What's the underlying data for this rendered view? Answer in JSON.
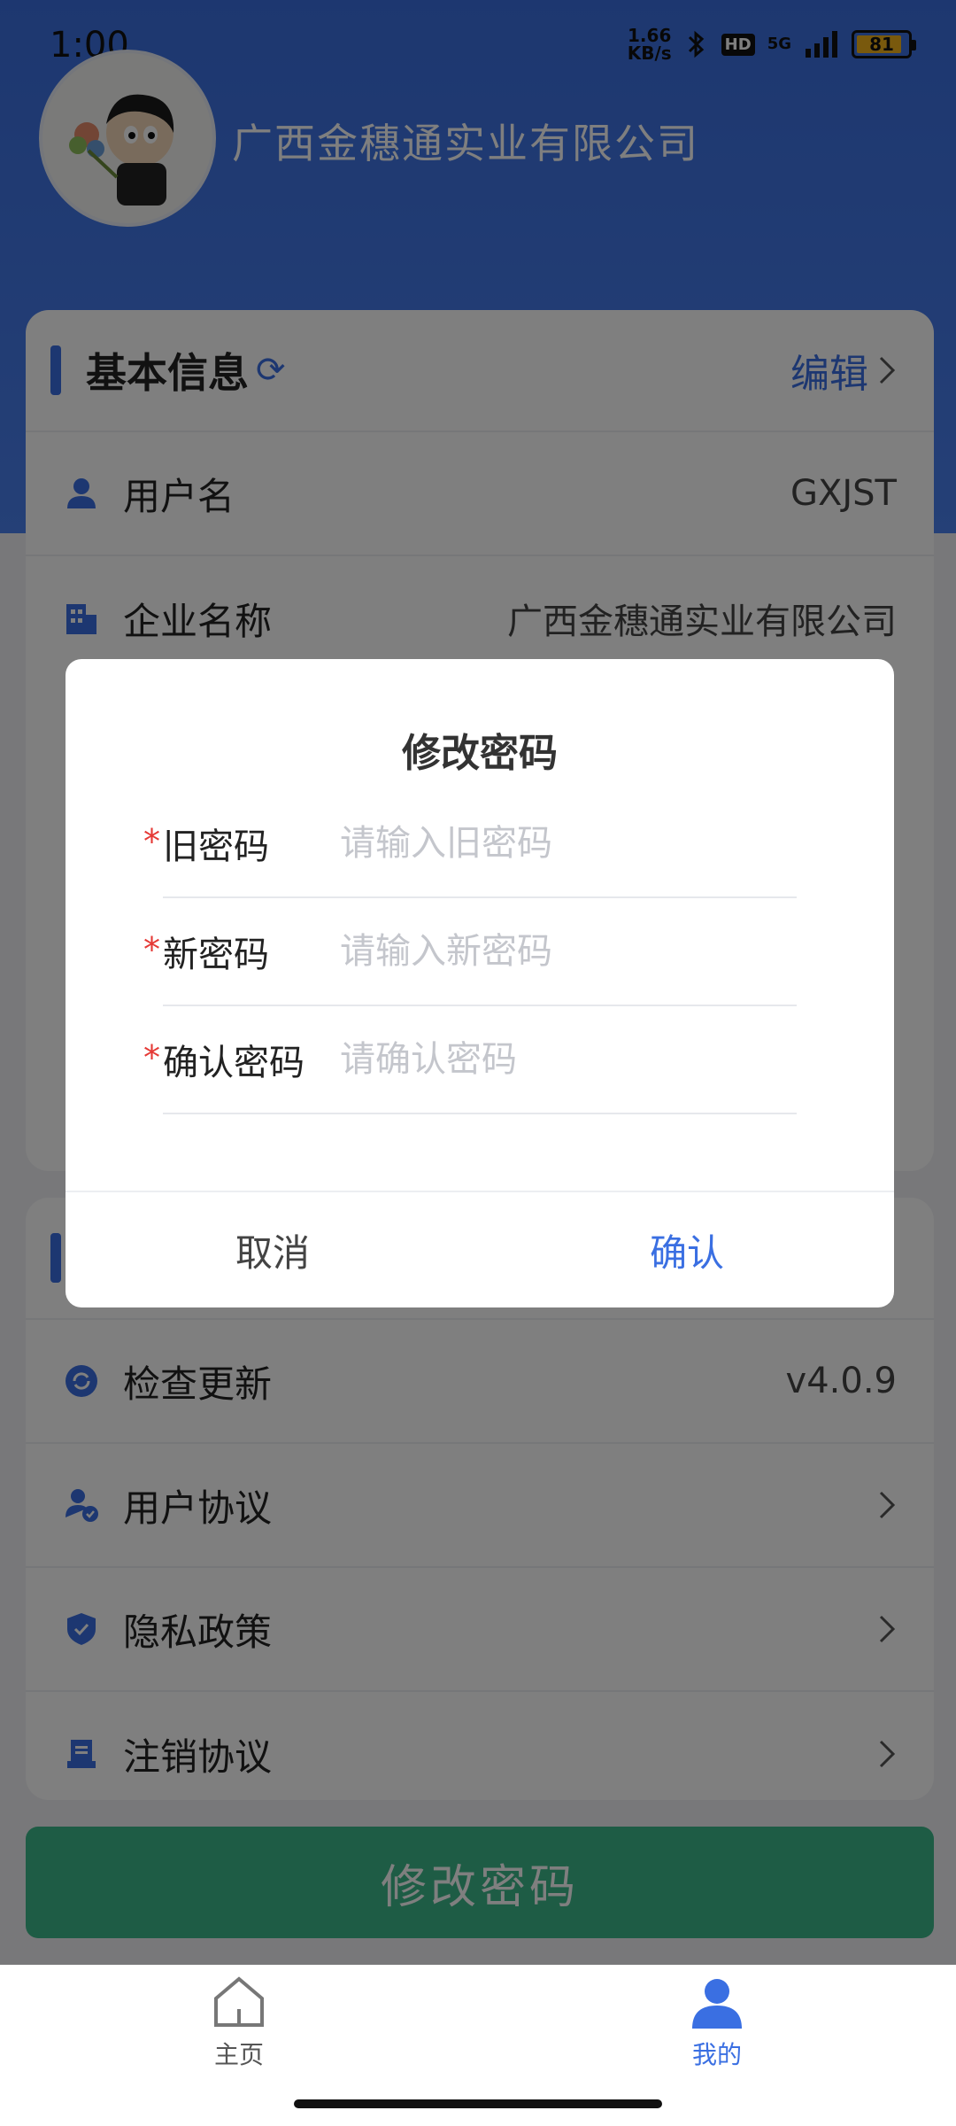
{
  "status": {
    "time": "1:00",
    "net_speed_top": "1.66",
    "net_speed_bottom": "KB/s",
    "hd": "HD",
    "signal": "5G",
    "battery": "81"
  },
  "header": {
    "company_name": "广西金穗通实业有限公司"
  },
  "basic_info": {
    "title": "基本信息",
    "edit_label": "编辑",
    "rows": [
      {
        "label": "用户名",
        "value": "GXJST"
      },
      {
        "label": "企业名称",
        "value": "广西金穗通实业有限公司"
      }
    ]
  },
  "system": {
    "rows": [
      {
        "label": "检查更新",
        "value": "v4.0.9"
      },
      {
        "label": "用户协议"
      },
      {
        "label": "隐私政策"
      },
      {
        "label": "注销协议"
      }
    ]
  },
  "primary_button": "修改密码",
  "tabs": [
    {
      "label": "主页"
    },
    {
      "label": "我的"
    }
  ],
  "dialog": {
    "title": "修改密码",
    "fields": [
      {
        "label": "旧密码",
        "placeholder": "请输入旧密码"
      },
      {
        "label": "新密码",
        "placeholder": "请输入新密码"
      },
      {
        "label": "确认密码",
        "placeholder": "请确认密码"
      }
    ],
    "cancel": "取消",
    "confirm": "确认"
  },
  "colors": {
    "accent": "#3a6fe2",
    "primary_button": "#3cb88a",
    "required": "#e53935"
  }
}
